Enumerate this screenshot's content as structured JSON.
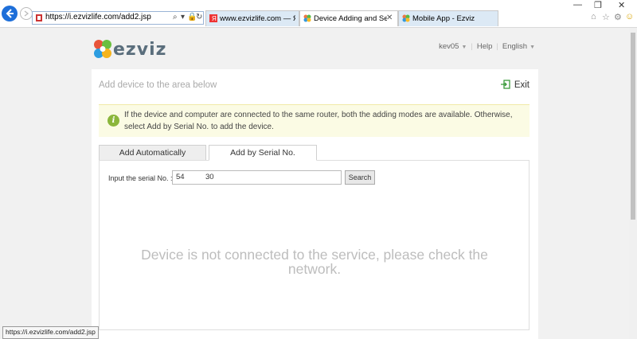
{
  "browser": {
    "address": "https://i.ezvizlife.com/add2.jsp",
    "tabs": [
      {
        "label": "www.ezvizlife.com — Яндекс:",
        "active": false
      },
      {
        "label": "Device Adding and Settings",
        "active": true
      },
      {
        "label": "Mobile App - Ezviz",
        "active": false
      }
    ],
    "status_url": "https://i.ezvizlife.com/add2.jsp"
  },
  "site": {
    "logo_text": "ezviz",
    "user": "kev05",
    "help": "Help",
    "language": "English"
  },
  "panel": {
    "title": "Add device to the area below",
    "exit_label": "Exit",
    "notice": "If the device and computer are connected to the same router, both the adding modes are available. Otherwise, select Add by Serial No. to add the device.",
    "tabs": [
      "Add Automatically",
      "Add by Serial No."
    ],
    "serial_label": "Input the serial No.  :",
    "serial_value": "54          30",
    "search_label": "Search",
    "status_message": "Device is not connected to the service, please check the network."
  },
  "colors": {
    "accent": "#1e6fd9",
    "notice_bg": "#fbfbe4",
    "info_icon": "#8bb63b"
  }
}
